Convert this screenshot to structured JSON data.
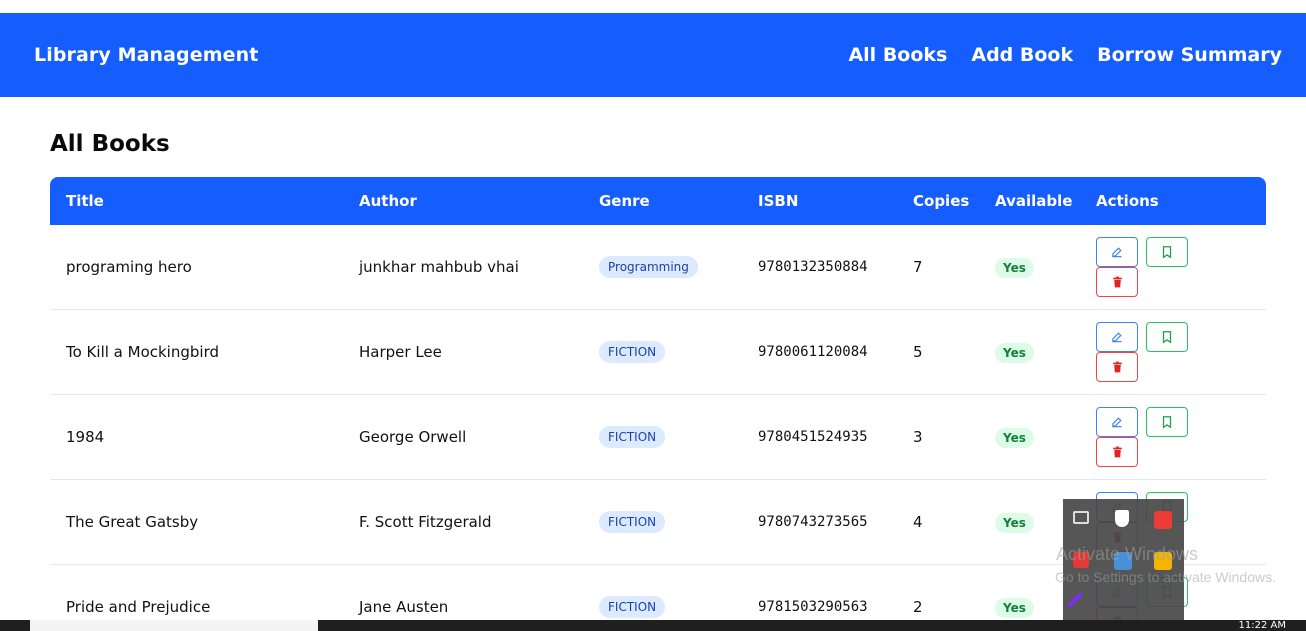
{
  "app": {
    "brand": "Library Management",
    "nav": [
      "All Books",
      "Add Book",
      "Borrow Summary"
    ]
  },
  "page": {
    "title": "All Books"
  },
  "table": {
    "headers": [
      "Title",
      "Author",
      "Genre",
      "ISBN",
      "Copies",
      "Available",
      "Actions"
    ],
    "rows": [
      {
        "title": "programing hero",
        "author": "junkhar mahbub vhai",
        "genre": "Programming",
        "isbn": "9780132350884",
        "copies": "7",
        "available": "Yes"
      },
      {
        "title": "To Kill a Mockingbird",
        "author": "Harper Lee",
        "genre": "FICTION",
        "isbn": "9780061120084",
        "copies": "5",
        "available": "Yes"
      },
      {
        "title": "1984",
        "author": "George Orwell",
        "genre": "FICTION",
        "isbn": "9780451524935",
        "copies": "3",
        "available": "Yes"
      },
      {
        "title": "The Great Gatsby",
        "author": "F. Scott Fitzgerald",
        "genre": "FICTION",
        "isbn": "9780743273565",
        "copies": "4",
        "available": "Yes"
      },
      {
        "title": "Pride and Prejudice",
        "author": "Jane Austen",
        "genre": "FICTION",
        "isbn": "9781503290563",
        "copies": "2",
        "available": "Yes"
      }
    ],
    "action_icons": [
      "pencil-icon",
      "bookmark-icon",
      "trash-icon"
    ]
  },
  "system": {
    "watermark_line1": "Activate Windows",
    "watermark_line2": "Go to Settings to activate Windows.",
    "clock": "11:22 AM"
  },
  "colors": {
    "primary": "#155dfc",
    "edit": "#3b82f6",
    "borrow": "#22c55e",
    "delete": "#ef4444",
    "genre_badge_bg": "#dbeafe",
    "available_badge_bg": "#dcfce7"
  }
}
